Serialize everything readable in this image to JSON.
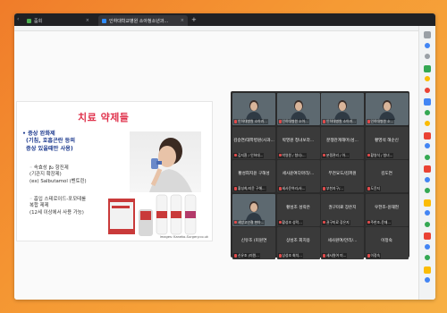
{
  "browser": {
    "tabs": [
      {
        "title": "줌회",
        "favicon_color": "#4caf50"
      },
      {
        "title": "인하대학교병원 소아청소년과...",
        "favicon_color": "#2d8cff"
      }
    ],
    "new_tab_symbol": "+",
    "close_symbol": "×",
    "back_symbol": "‹"
  },
  "slide": {
    "title": "치료 약제들",
    "bullet1": "• 증상 완화제",
    "bullet1_sub1": "(기침, 호흡곤란 등의",
    "bullet1_sub2": "증상 있을때만 사용)",
    "bullet2_line1": "◦ 속효성 β₂ 항진제",
    "bullet2_line2": "(기관지 확장제)",
    "bullet2_line3": "(ex) Salbutamol (벤토린)",
    "bullet3_line1": "◦ 흡입 스테로이드-포모테롤",
    "bullet3_line2": "복합 제제",
    "bullet3_line3": "(12세 이상에서 사용 가능)",
    "credit": "images: Kaneko-Surgery.co.uk"
  },
  "participants": [
    {
      "name": "인하대병원 소아과...",
      "video": true,
      "row": 0,
      "col": 0
    },
    {
      "name": "인하대병원 소아...",
      "video": true,
      "row": 0,
      "col": 1
    },
    {
      "name": "인하대병원 소아과...",
      "video": true,
      "row": 0,
      "col": 2
    },
    {
      "name": "인하대병원 소...",
      "video": true,
      "row": 0,
      "col": 3
    },
    {
      "name": "김지환 / 인하대...",
      "video": false,
      "center": "김승연/대학병원(사과...",
      "row": 1,
      "col": 0
    },
    {
      "name": "박영원 / 청녀/...",
      "video": false,
      "center": "박영원 청녀보라...",
      "row": 1,
      "col": 1
    },
    {
      "name": "분쟁관리 / 아...",
      "video": false,
      "center": "분쟁관계해머(성...",
      "row": 1,
      "col": 2
    },
    {
      "name": "황영석 / 청녀...",
      "video": false,
      "center": "황영석 해순신",
      "row": 1,
      "col": 3
    },
    {
      "name": "황성희/지윤 구해...",
      "video": false,
      "center": "황성희지윤 구해성",
      "row": 2,
      "col": 0
    },
    {
      "name": "세사윤여리/사...",
      "video": false,
      "center": "세사윤여다마리/...",
      "row": 2,
      "col": 1
    },
    {
      "name": "부천지구/... ",
      "video": false,
      "center": "부천요도/김퍼원",
      "row": 2,
      "col": 2
    },
    {
      "name": "도윤지",
      "video": false,
      "center": "김도연",
      "row": 2,
      "col": 3
    },
    {
      "name": "세방고인철 현아...",
      "video": true,
      "row": 3,
      "col": 0
    },
    {
      "name": "황성조 성락...",
      "video": false,
      "center": "황성조 성락은",
      "row": 3,
      "col": 1
    },
    {
      "name": "권구미료 장은지",
      "video": false,
      "center": "권구미료 장은지",
      "row": 3,
      "col": 2
    },
    {
      "name": "주한조-윤재...",
      "video": false,
      "center": "우한조-윤재현",
      "row": 3,
      "col": 3
    },
    {
      "name": "신유조 (미원...",
      "video": false,
      "center": "신유조 (미원연",
      "row": 4,
      "col": 0
    },
    {
      "name": "상성조 회치...",
      "video": false,
      "center": "상성조 회치용",
      "row": 4,
      "col": 1
    },
    {
      "name": "세사원여 미...",
      "video": false,
      "center": "세사원여/만리/...",
      "row": 4,
      "col": 2
    },
    {
      "name": "이정숙",
      "video": false,
      "center": "이정숙",
      "row": 4,
      "col": 3
    }
  ],
  "extensions": {
    "colors": [
      "#9aa0a6",
      "#4285f4",
      "#9aa0a6",
      "#34a853",
      "#fbbc05",
      "#ea4335",
      "#4285f4",
      "#34a853",
      "#fbbc05",
      "#ea4335",
      "#4285f4",
      "#34a853",
      "#ea4335",
      "#4285f4",
      "#34a853",
      "#fbbc05",
      "#4285f4",
      "#34a853",
      "#ea4335",
      "#4285f4",
      "#34a853",
      "#fbbc05",
      "#4285f4"
    ]
  }
}
